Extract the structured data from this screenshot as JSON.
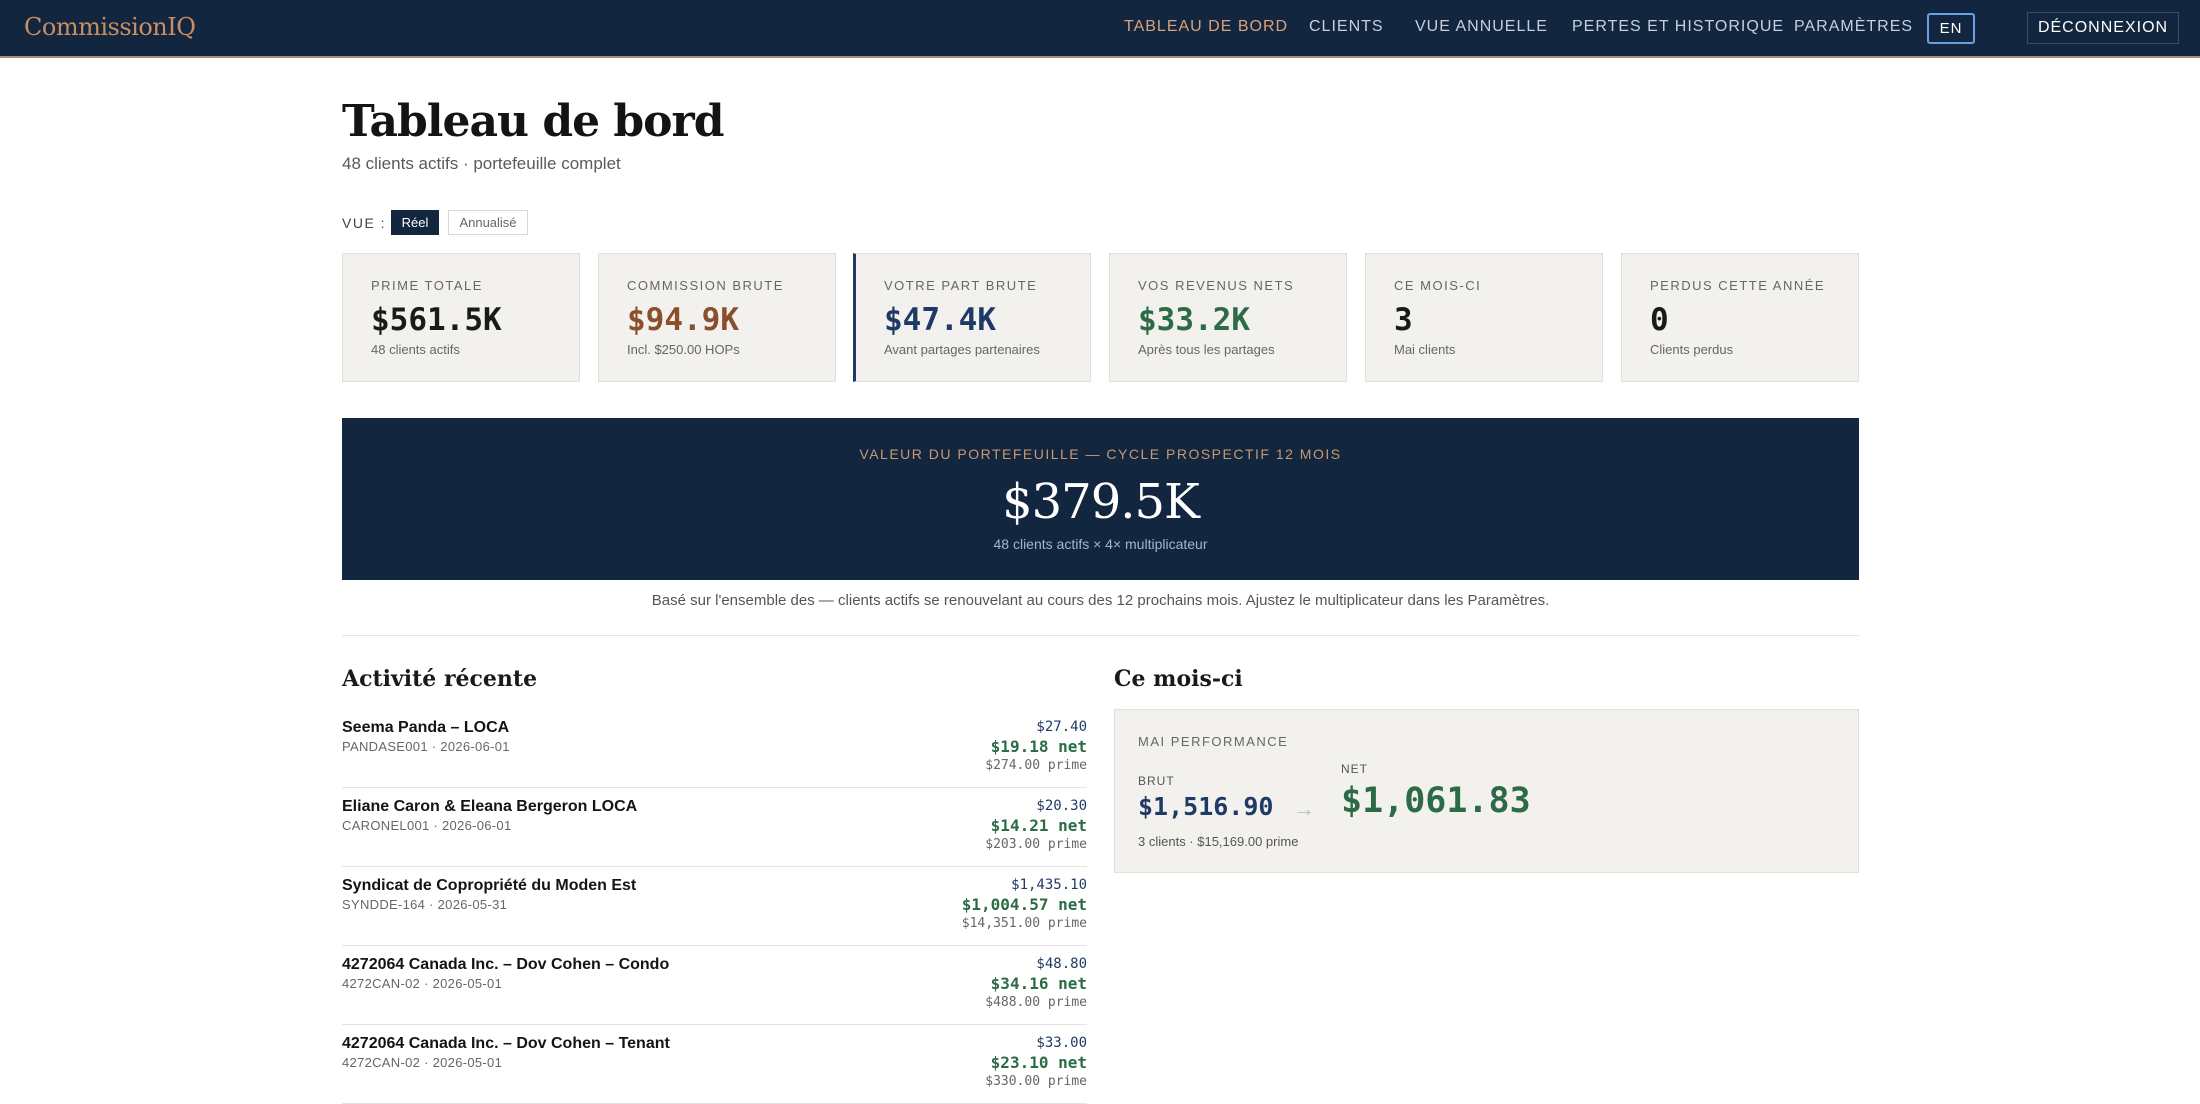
{
  "app": {
    "brand": "CommissionIQ"
  },
  "nav": {
    "items": [
      {
        "label": "TABLEAU DE BORD"
      },
      {
        "label": "CLIENTS"
      },
      {
        "label": "VUE ANNUELLE"
      },
      {
        "label": "PERTES ET HISTORIQUE"
      },
      {
        "label": "PARAMÈTRES"
      }
    ],
    "lang": "EN",
    "logout": "DÉCONNEXION"
  },
  "header": {
    "title": "Tableau de bord",
    "subtitle": "48 clients actifs · portefeuille complet"
  },
  "view": {
    "label": "VUE :",
    "options": [
      {
        "label": "Réel"
      },
      {
        "label": "Annualisé"
      }
    ],
    "selected": "Réel"
  },
  "cards": [
    {
      "label": "PRIME TOTALE",
      "value": "$561.5K",
      "note": "48 clients actifs",
      "color": "#1a1a1a"
    },
    {
      "label": "COMMISSION BRUTE",
      "value": "$94.9K",
      "note": "Incl. $250.00 HOPs",
      "color": "#8a4e2a"
    },
    {
      "label": "VOTRE PART BRUTE",
      "value": "$47.4K",
      "note": "Avant partages partenaires",
      "color": "#1f3a66"
    },
    {
      "label": "VOS REVENUS NETS",
      "value": "$33.2K",
      "note": "Après tous les partages",
      "color": "#2d6b47"
    },
    {
      "label": "CE MOIS-CI",
      "value": "3",
      "note": "Mai clients",
      "color": "#1a1a1a"
    },
    {
      "label": "PERDUS CETTE ANNÉE",
      "value": "0",
      "note": "Clients perdus",
      "color": "#1a1a1a"
    }
  ],
  "portfolio": {
    "label": "VALEUR DU PORTEFEUILLE — CYCLE PROSPECTIF 12 MOIS",
    "value": "$379.5K",
    "note": "48 clients actifs × 4× multiplicateur",
    "caption": "Basé sur l'ensemble des — clients actifs se renouvelant au cours des 12 prochains mois. Ajustez le multiplicateur dans les Paramètres."
  },
  "activity": {
    "title": "Activité récente",
    "rows": [
      {
        "name": "Seema Panda – LOCA",
        "meta": "PANDASE001 · 2026-06-01",
        "amount": "$27.40",
        "net": "$19.18 net",
        "prime": "$274.00 prime"
      },
      {
        "name": "Eliane Caron & Eleana Bergeron LOCA",
        "meta": "CARONEL001 · 2026-06-01",
        "amount": "$20.30",
        "net": "$14.21 net",
        "prime": "$203.00 prime"
      },
      {
        "name": "Syndicat de Copropriété du Moden Est",
        "meta": "SYNDDE-164 · 2026-05-31",
        "amount": "$1,435.10",
        "net": "$1,004.57 net",
        "prime": "$14,351.00 prime"
      },
      {
        "name": "4272064 Canada Inc. – Dov Cohen – Condo",
        "meta": "4272CAN-02 · 2026-05-01",
        "amount": "$48.80",
        "net": "$34.16 net",
        "prime": "$488.00 prime"
      },
      {
        "name": "4272064 Canada Inc. – Dov Cohen – Tenant",
        "meta": "4272CAN-02 · 2026-05-01",
        "amount": "$33.00",
        "net": "$23.10 net",
        "prime": "$330.00 prime"
      }
    ]
  },
  "month": {
    "title": "Ce mois-ci",
    "label": "MAI PERFORMANCE",
    "brut_label": "BRUT",
    "brut": "$1,516.90",
    "arrow": "→",
    "net_label": "NET",
    "net": "$1,061.83",
    "note": "3 clients · $15,169.00 prime"
  }
}
